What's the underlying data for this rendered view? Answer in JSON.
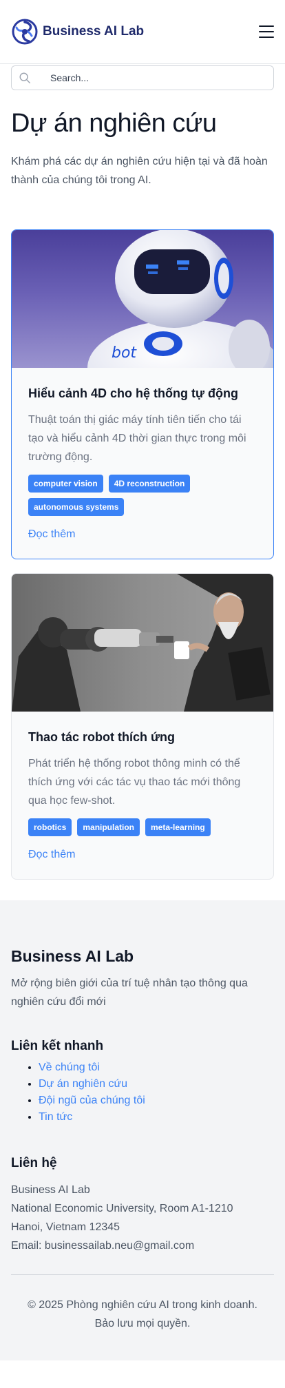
{
  "header": {
    "brand": "Business AI Lab"
  },
  "search": {
    "placeholder": "Search..."
  },
  "page": {
    "title": "Dự án nghiên cứu",
    "description": "Khám phá các dự án nghiên cứu hiện tại và đã hoàn thành của chúng tôi trong AI."
  },
  "projects": [
    {
      "title": "Hiểu cảnh 4D cho hệ thống tự động",
      "description": "Thuật toán thị giác máy tính tiên tiến cho tái tạo và hiểu cảnh 4D thời gian thực trong môi trường động.",
      "tags": [
        "computer vision",
        "4D reconstruction",
        "autonomous systems"
      ],
      "link": "Đọc thêm"
    },
    {
      "title": "Thao tác robot thích ứng",
      "description": "Phát triển hệ thống robot thông minh có thể thích ứng với các tác vụ thao tác mới thông qua học few-shot.",
      "tags": [
        "robotics",
        "manipulation",
        "meta-learning"
      ],
      "link": "Đọc thêm"
    }
  ],
  "footer": {
    "brand": "Business AI Lab",
    "tagline": "Mở rộng biên giới của trí tuệ nhân tạo thông qua nghiên cứu đổi mới",
    "quick_links_title": "Liên kết nhanh",
    "quick_links": [
      "Về chúng tôi",
      "Dự án nghiên cứu",
      "Đội ngũ của chúng tôi",
      "Tin tức"
    ],
    "contact_title": "Liên hệ",
    "contact": {
      "name": "Business AI Lab",
      "address1": "National Economic University, Room A1-1210",
      "address2": "Hanoi, Vietnam 12345",
      "email": "Email: businessailab.neu@gmail.com"
    },
    "copyright": "© 2025 Phòng nghiên cứu AI trong kinh doanh. Bảo lưu mọi quyền."
  },
  "colors": {
    "accent": "#3b82f6",
    "brand": "#1f2a6b",
    "footer_bg": "#f3f4f6"
  }
}
